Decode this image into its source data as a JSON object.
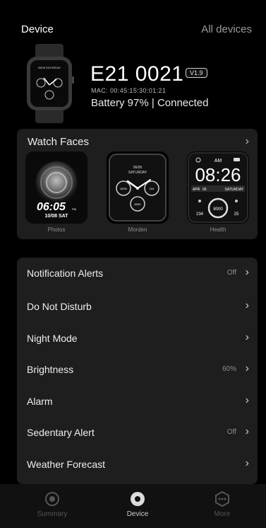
{
  "topbar": {
    "title": "Device",
    "all_devices": "All devices"
  },
  "device": {
    "name": "E21 0021",
    "version": "V1.9",
    "mac": "MAC: 00:45:15:30:01:21",
    "battery": "Battery 97% | Connected",
    "watch_screen_date": "06/08 SATURDAY"
  },
  "watch_faces": {
    "header": "Watch Faces",
    "items": [
      {
        "label": "Photos",
        "time": "06:05",
        "ampm": "PM",
        "date": "10/08 SAT"
      },
      {
        "label": "Morden",
        "date_top": "06/06",
        "day": "SATURDAY",
        "dial_left": "100%",
        "dial_right": "244",
        "dial_bottom": "8000"
      },
      {
        "label": "Health",
        "ampm": "AM",
        "time": "08:26",
        "month": "APR",
        "day_num": "06",
        "weekday": "SATURDAY",
        "left_val": "234",
        "center_val": "8000",
        "right_val": "25"
      }
    ]
  },
  "menu": [
    {
      "label": "Notification Alerts",
      "value": "Off"
    },
    {
      "label": "Do Not Disturb",
      "value": ""
    },
    {
      "label": "Night Mode",
      "value": ""
    },
    {
      "label": "Brightness",
      "value": "60%"
    },
    {
      "label": "Alarm",
      "value": ""
    },
    {
      "label": "Sedentary Alert",
      "value": "Off"
    },
    {
      "label": "Weather Forecast",
      "value": ""
    }
  ],
  "tabs": [
    {
      "label": "Summary",
      "icon": "summary-icon",
      "active": false
    },
    {
      "label": "Device",
      "icon": "device-icon",
      "active": true
    },
    {
      "label": "More",
      "icon": "more-icon",
      "active": false
    }
  ],
  "colors": {
    "background": "#000000",
    "panel": "#1e1e1e",
    "muted": "#8d8d8d",
    "tab_active": "#cfcfcf",
    "tab_inactive": "#555555"
  }
}
